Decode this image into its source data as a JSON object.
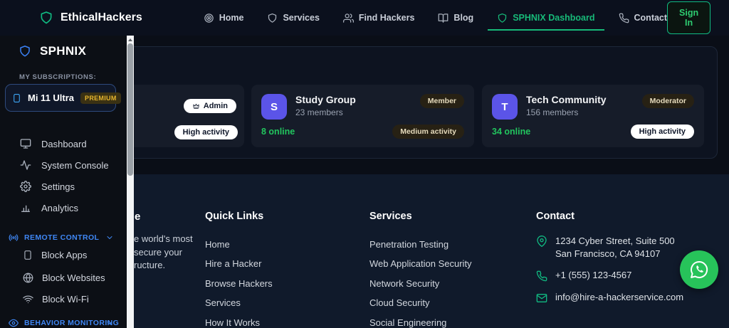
{
  "colors": {
    "accent_green": "#10b981",
    "online_green": "#22c55e",
    "sidebar_blue": "#3b82f6",
    "whatsapp_green": "#27c35a",
    "premium_gold": "#e8b62e",
    "avatar_purple": "#5b54e8"
  },
  "navbar": {
    "brand": "EthicalHackers",
    "items": [
      {
        "label": "Home",
        "icon": "target-icon",
        "active": false
      },
      {
        "label": "Services",
        "icon": "shield-icon",
        "active": false
      },
      {
        "label": "Find Hackers",
        "icon": "users-icon",
        "active": false
      },
      {
        "label": "Blog",
        "icon": "book-icon",
        "active": false
      },
      {
        "label": "SPHNIX Dashboard",
        "icon": "shield-icon",
        "active": true
      },
      {
        "label": "Contact",
        "icon": "phone-icon",
        "active": false
      }
    ],
    "sign_in_label": "Sign In"
  },
  "sidebar": {
    "title": "SPHNIX",
    "subscriptions_label": "MY SUBSCRIPTIONS:",
    "device": {
      "name": "Mi 11 Ultra",
      "badge": "PREMIUM",
      "icon": "smartphone-icon"
    },
    "menu": [
      {
        "label": "Dashboard",
        "icon": "monitor-icon"
      },
      {
        "label": "System Console",
        "icon": "activity-icon"
      },
      {
        "label": "Settings",
        "icon": "gear-icon"
      },
      {
        "label": "Analytics",
        "icon": "bar-chart-icon"
      }
    ],
    "remote_control": {
      "label": "REMOTE CONTROL",
      "icon": "broadcast-icon",
      "items": [
        {
          "label": "Block Apps",
          "icon": "smartphone-icon"
        },
        {
          "label": "Block Websites",
          "icon": "globe-icon"
        },
        {
          "label": "Block Wi-Fi",
          "icon": "wifi-icon"
        }
      ]
    },
    "behavior_monitoring": {
      "label": "BEHAVIOR MONITORING",
      "icon": "eye-icon"
    }
  },
  "groups": {
    "cards": [
      {
        "role_badge": "Admin",
        "role_icon": "crown-icon",
        "activity_badge": "High activity"
      },
      {
        "initial": "S",
        "name": "Study Group",
        "members": "23 members",
        "online": "8 online",
        "role_badge": "Member",
        "activity_badge": "Medium activity"
      },
      {
        "initial": "T",
        "name": "Tech Community",
        "members": "156 members",
        "online": "34 online",
        "role_badge": "Moderator",
        "activity_badge": "High activity"
      }
    ]
  },
  "footer": {
    "about": {
      "heading_fragment": "e",
      "description_fragment": "e world's most\nsecure your\nructure."
    },
    "quick_links": {
      "heading": "Quick Links",
      "links": [
        "Home",
        "Hire a Hacker",
        "Browse Hackers",
        "Services",
        "How It Works"
      ]
    },
    "services": {
      "heading": "Services",
      "links": [
        "Penetration Testing",
        "Web Application Security",
        "Network Security",
        "Cloud Security",
        "Social Engineering"
      ]
    },
    "contact": {
      "heading": "Contact",
      "address_line1": "1234 Cyber Street, Suite 500",
      "address_line2": "San Francisco, CA 94107",
      "phone": "+1 (555) 123-4567",
      "email": "info@hire-a-hackerservice.com"
    }
  }
}
